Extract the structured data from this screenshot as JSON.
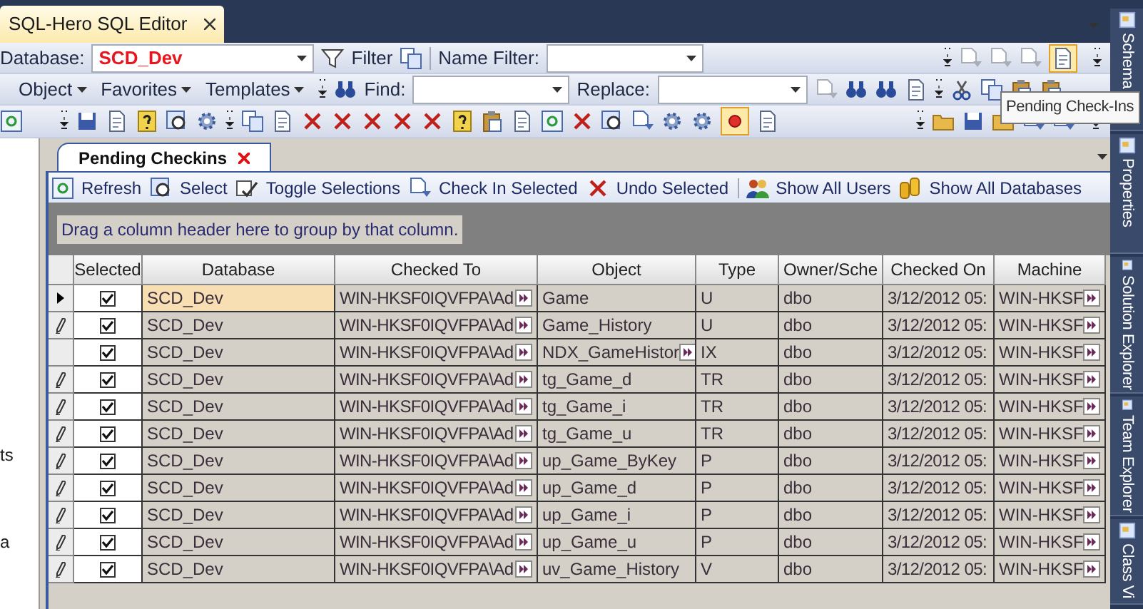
{
  "editor_tab": {
    "title": "SQL-Hero SQL Editor"
  },
  "toolbar_1": {
    "database_label": "Database:",
    "database_value": "SCD_Dev",
    "filter_label": "Filter",
    "name_filter_label": "Name Filter:",
    "pending_checkins_active": true
  },
  "toolbar_2": {
    "menus": [
      "Object",
      "Favorites",
      "Templates"
    ],
    "find_label": "Find:",
    "replace_label": "Replace:"
  },
  "toolbar_3": {
    "record_active": true
  },
  "tooltip": "Pending Check-Ins",
  "left_panel": [
    "ts",
    "a"
  ],
  "document_tab": {
    "title": "Pending Checkins"
  },
  "actions": [
    "Refresh",
    "Select",
    "Toggle Selections",
    "Check In Selected",
    "Undo Selected",
    "Show All Users",
    "Show All Databases"
  ],
  "group_hint": "Drag a column header here to group by that column.",
  "table": {
    "columns": [
      "Selected",
      "Database",
      "Checked To",
      "Object",
      "Type",
      "Owner/Sche",
      "Checked On",
      "Machine"
    ],
    "rows": [
      {
        "kind": "current",
        "selected": true,
        "checked": true,
        "database": "SCD_Dev",
        "checked_to": "WIN-HKSF0IQVFPA\\Ad",
        "object": "Game",
        "object_more": false,
        "type": "U",
        "owner": "dbo",
        "checked_on": "3/12/2012 05:",
        "machine": "WIN-HKSF"
      },
      {
        "kind": "edit",
        "selected": false,
        "checked": true,
        "database": "SCD_Dev",
        "checked_to": "WIN-HKSF0IQVFPA\\Ad",
        "object": "Game_History",
        "object_more": false,
        "type": "U",
        "owner": "dbo",
        "checked_on": "3/12/2012 05:",
        "machine": "WIN-HKSF"
      },
      {
        "kind": "none",
        "selected": false,
        "checked": true,
        "database": "SCD_Dev",
        "checked_to": "WIN-HKSF0IQVFPA\\Ad",
        "object": "NDX_GameHistor",
        "object_more": true,
        "type": "IX",
        "owner": "dbo",
        "checked_on": "3/12/2012 05:",
        "machine": "WIN-HKSF"
      },
      {
        "kind": "edit",
        "selected": false,
        "checked": true,
        "database": "SCD_Dev",
        "checked_to": "WIN-HKSF0IQVFPA\\Ad",
        "object": "tg_Game_d",
        "object_more": false,
        "type": "TR",
        "owner": "dbo",
        "checked_on": "3/12/2012 05:",
        "machine": "WIN-HKSF"
      },
      {
        "kind": "edit",
        "selected": false,
        "checked": true,
        "database": "SCD_Dev",
        "checked_to": "WIN-HKSF0IQVFPA\\Ad",
        "object": "tg_Game_i",
        "object_more": false,
        "type": "TR",
        "owner": "dbo",
        "checked_on": "3/12/2012 05:",
        "machine": "WIN-HKSF"
      },
      {
        "kind": "edit",
        "selected": false,
        "checked": true,
        "database": "SCD_Dev",
        "checked_to": "WIN-HKSF0IQVFPA\\Ad",
        "object": "tg_Game_u",
        "object_more": false,
        "type": "TR",
        "owner": "dbo",
        "checked_on": "3/12/2012 05:",
        "machine": "WIN-HKSF"
      },
      {
        "kind": "edit",
        "selected": false,
        "checked": true,
        "database": "SCD_Dev",
        "checked_to": "WIN-HKSF0IQVFPA\\Ad",
        "object": "up_Game_ByKey",
        "object_more": false,
        "type": "P",
        "owner": "dbo",
        "checked_on": "3/12/2012 05:",
        "machine": "WIN-HKSF"
      },
      {
        "kind": "edit",
        "selected": false,
        "checked": true,
        "database": "SCD_Dev",
        "checked_to": "WIN-HKSF0IQVFPA\\Ad",
        "object": "up_Game_d",
        "object_more": false,
        "type": "P",
        "owner": "dbo",
        "checked_on": "3/12/2012 05:",
        "machine": "WIN-HKSF"
      },
      {
        "kind": "edit",
        "selected": false,
        "checked": true,
        "database": "SCD_Dev",
        "checked_to": "WIN-HKSF0IQVFPA\\Ad",
        "object": "up_Game_i",
        "object_more": false,
        "type": "P",
        "owner": "dbo",
        "checked_on": "3/12/2012 05:",
        "machine": "WIN-HKSF"
      },
      {
        "kind": "edit",
        "selected": false,
        "checked": true,
        "database": "SCD_Dev",
        "checked_to": "WIN-HKSF0IQVFPA\\Ad",
        "object": "up_Game_u",
        "object_more": false,
        "type": "P",
        "owner": "dbo",
        "checked_on": "3/12/2012 05:",
        "machine": "WIN-HKSF"
      },
      {
        "kind": "edit",
        "selected": false,
        "checked": true,
        "database": "SCD_Dev",
        "checked_to": "WIN-HKSF0IQVFPA\\Ad",
        "object": "uv_Game_History",
        "object_more": false,
        "type": "V",
        "owner": "dbo",
        "checked_on": "3/12/2012 05:",
        "machine": "WIN-HKSF"
      }
    ]
  },
  "side_tabs": [
    "Schema",
    "Properties",
    "Solution Explorer",
    "Team Explorer",
    "Class Vi"
  ]
}
